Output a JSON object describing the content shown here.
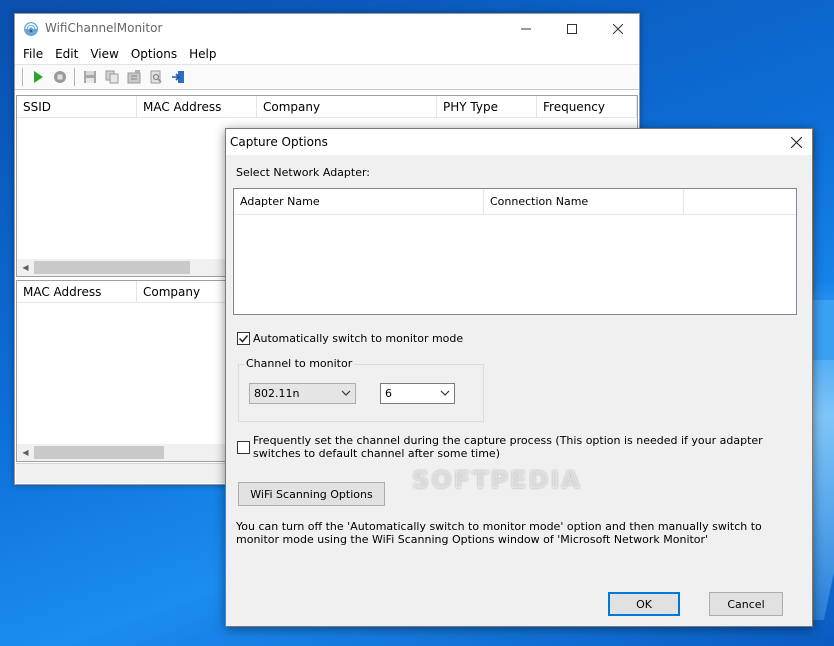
{
  "main_window": {
    "title": "WifiChannelMonitor",
    "menu": [
      "File",
      "Edit",
      "View",
      "Options",
      "Help"
    ],
    "list1_columns": [
      "SSID",
      "MAC Address",
      "Company",
      "PHY Type",
      "Frequency"
    ],
    "list2_columns": [
      "MAC Address",
      "Company"
    ]
  },
  "dialog": {
    "title": "Capture Options",
    "select_adapter_label": "Select Network Adapter:",
    "adapter_columns": [
      "Adapter Name",
      "Connection Name"
    ],
    "auto_switch_label": "Automatically switch to monitor mode",
    "auto_switch_checked": true,
    "channel_group_label": "Channel to monitor",
    "phy_selected": "802.11n",
    "channel_selected": "6",
    "frequent_label": "Frequently set the channel during the capture process (This option is needed if your adapter switches to default channel after some time)",
    "frequent_checked": false,
    "scan_button": "WiFi Scanning Options",
    "info_text": "You can turn off the 'Automatically switch to monitor mode' option and then manually switch to monitor mode using the WiFi Scanning Options window of 'Microsoft Network Monitor'",
    "ok_button": "OK",
    "cancel_button": "Cancel"
  },
  "watermark": "SOFTPEDIA",
  "colors": {
    "accent": "#0078d7",
    "desktop": "#0d6fd8"
  }
}
